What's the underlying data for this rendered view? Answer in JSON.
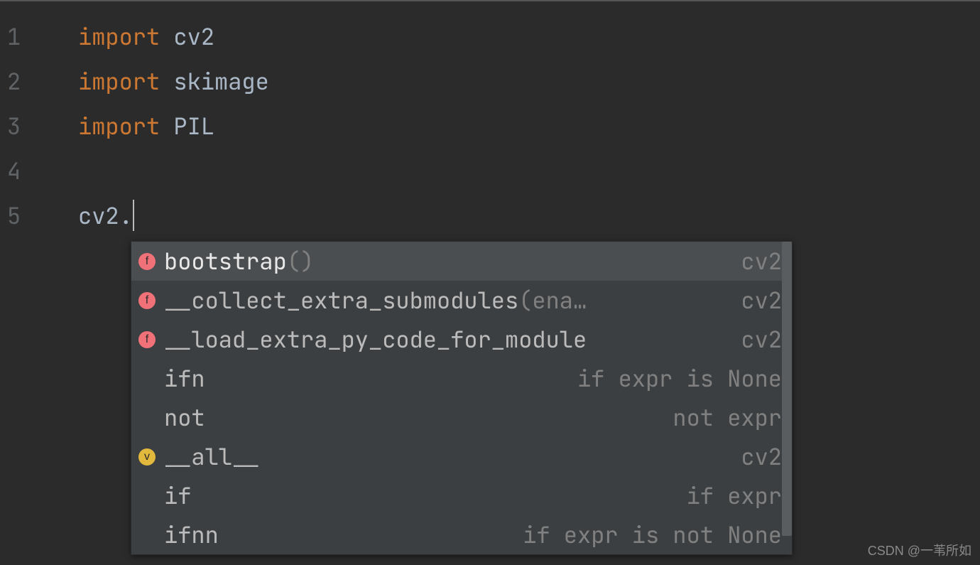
{
  "gutter": {
    "lines": [
      "1",
      "2",
      "3",
      "4",
      "5"
    ]
  },
  "code": {
    "lines": [
      {
        "kw": "import",
        "rest": " cv2"
      },
      {
        "kw": "import",
        "rest": " skimage"
      },
      {
        "kw": "import",
        "rest": " PIL"
      },
      {
        "kw": "",
        "rest": ""
      },
      {
        "kw": "",
        "rest": "cv2."
      }
    ]
  },
  "popup": {
    "items": [
      {
        "icon": "f",
        "name": "bootstrap",
        "args": "()",
        "right": "cv2",
        "selected": true
      },
      {
        "icon": "f",
        "name": "__collect_extra_submodules",
        "args": "(ena…",
        "right": "cv2",
        "selected": false
      },
      {
        "icon": "f",
        "name": "__load_extra_py_code_for_module",
        "args": "",
        "right": "cv2",
        "selected": false
      },
      {
        "icon": "",
        "name": "ifn",
        "args": "",
        "right": "if expr is None",
        "selected": false
      },
      {
        "icon": "",
        "name": "not",
        "args": "",
        "right": "not expr",
        "selected": false
      },
      {
        "icon": "v",
        "name": "__all__",
        "args": "",
        "right": "cv2",
        "selected": false
      },
      {
        "icon": "",
        "name": "if",
        "args": "",
        "right": "if expr",
        "selected": false
      },
      {
        "icon": "",
        "name": "ifnn",
        "args": "",
        "right": "if expr is not None",
        "selected": false
      }
    ]
  },
  "watermark": "CSDN @一苇所如"
}
